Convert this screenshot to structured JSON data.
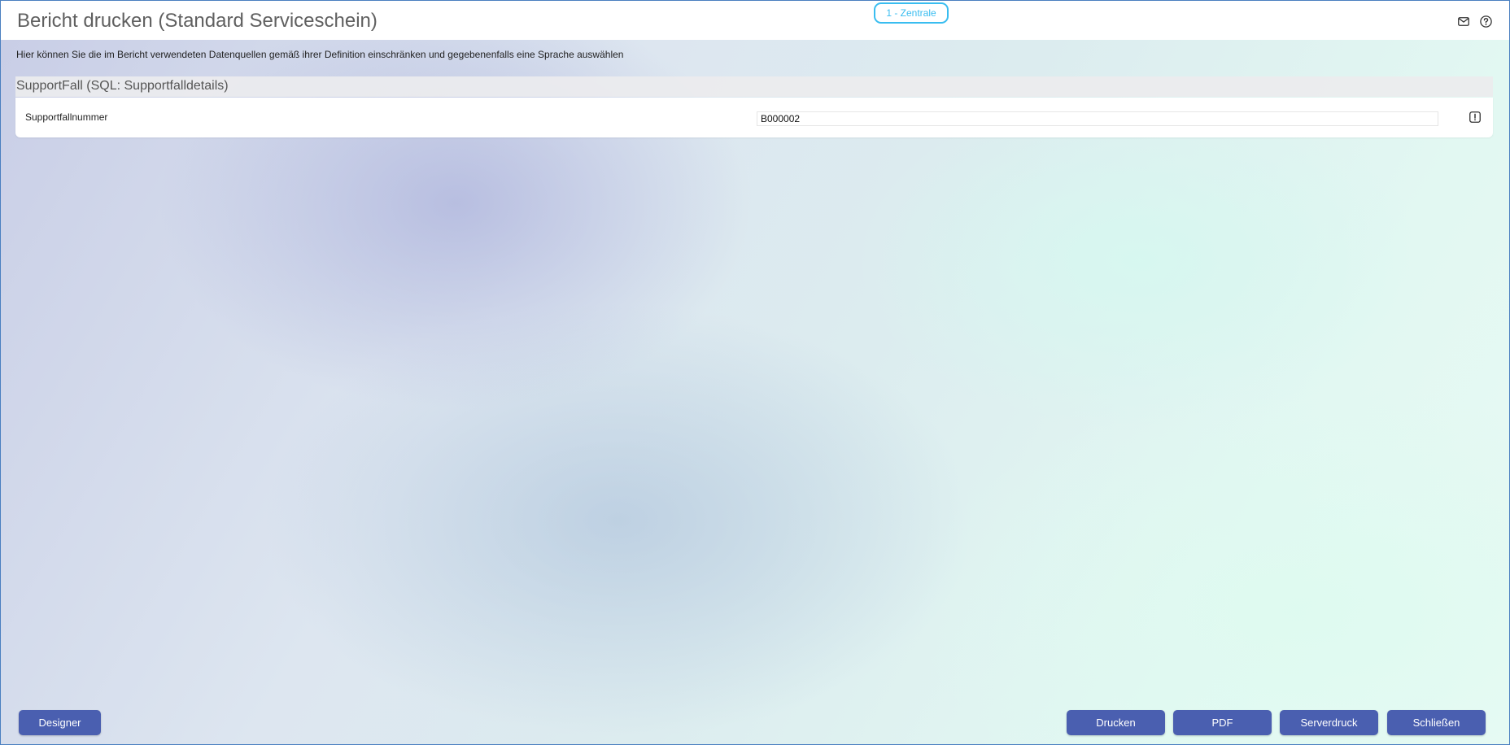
{
  "window": {
    "title": "Bericht drucken (Standard Serviceschein)",
    "branch_badge": "1 - Zentrale"
  },
  "header_icons": {
    "mail": "mail-icon",
    "help": "help-icon"
  },
  "intro": {
    "text": "Hier können Sie die im Bericht verwendeten Datenquellen gemäß ihrer Definition einschränken und gegebenenfalls eine Sprache auswählen"
  },
  "section": {
    "title": "SupportFall (SQL: Supportfalldetails)",
    "fields": [
      {
        "label": "Supportfallnummer",
        "value": "B000002",
        "action_icon": "alert-icon"
      }
    ]
  },
  "buttons": {
    "designer": "Designer",
    "drucken": "Drucken",
    "pdf": "PDF",
    "serverdruck": "Serverdruck",
    "schliessen": "Schließen"
  },
  "colors": {
    "accent": "#4a5fb0",
    "badge_border": "#39bdf0",
    "title_text": "#606060"
  }
}
